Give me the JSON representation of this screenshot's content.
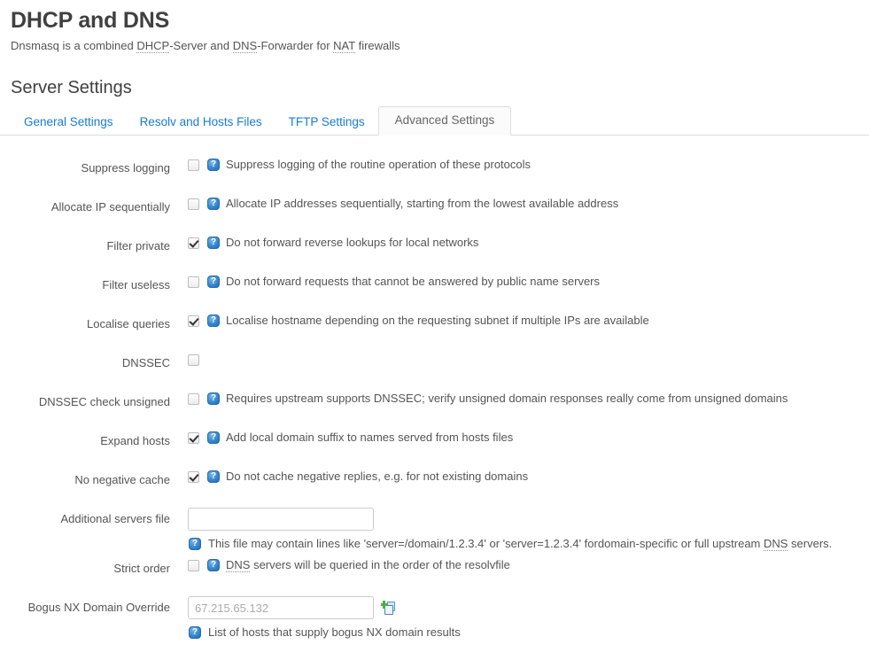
{
  "header": {
    "title": "DHCP and DNS",
    "subtitle_parts": [
      {
        "t": "Dnsmasq is a combined ",
        "abbr": false
      },
      {
        "t": "DHCP",
        "abbr": true
      },
      {
        "t": "-Server and ",
        "abbr": false
      },
      {
        "t": "DNS",
        "abbr": true
      },
      {
        "t": "-Forwarder for ",
        "abbr": false
      },
      {
        "t": "NAT",
        "abbr": true
      },
      {
        "t": " firewalls",
        "abbr": false
      }
    ],
    "subtitle_plain": "Dnsmasq is a combined DHCP-Server and DNS-Forwarder for NAT firewalls",
    "section_title": "Server Settings"
  },
  "tabs": [
    {
      "label": "General Settings",
      "active": false
    },
    {
      "label": "Resolv and Hosts Files",
      "active": false
    },
    {
      "label": "TFTP Settings",
      "active": false
    },
    {
      "label": "Advanced Settings",
      "active": true
    }
  ],
  "form": {
    "rows": [
      {
        "id": "suppress-logging",
        "label": "Suppress logging",
        "type": "checkbox",
        "checked": false,
        "help": "Suppress logging of the routine operation of these protocols"
      },
      {
        "id": "allocate-ip-sequentially",
        "label": "Allocate IP sequentially",
        "type": "checkbox",
        "checked": false,
        "help": "Allocate IP addresses sequentially, starting from the lowest available address"
      },
      {
        "id": "filter-private",
        "label": "Filter private",
        "type": "checkbox",
        "checked": true,
        "help": "Do not forward reverse lookups for local networks"
      },
      {
        "id": "filter-useless",
        "label": "Filter useless",
        "type": "checkbox",
        "checked": false,
        "help": "Do not forward requests that cannot be answered by public name servers"
      },
      {
        "id": "localise-queries",
        "label": "Localise queries",
        "type": "checkbox",
        "checked": true,
        "help": "Localise hostname depending on the requesting subnet if multiple IPs are available"
      },
      {
        "id": "dnssec",
        "label": "DNSSEC",
        "type": "checkbox",
        "checked": false,
        "help": ""
      },
      {
        "id": "dnssec-check-unsigned",
        "label": "DNSSEC check unsigned",
        "type": "checkbox",
        "checked": false,
        "help": "Requires upstream supports DNSSEC; verify unsigned domain responses really come from unsigned domains"
      },
      {
        "id": "expand-hosts",
        "label": "Expand hosts",
        "type": "checkbox",
        "checked": true,
        "help": "Add local domain suffix to names served from hosts files"
      },
      {
        "id": "no-negative-cache",
        "label": "No negative cache",
        "type": "checkbox",
        "checked": true,
        "help": "Do not cache negative replies, e.g. for not existing domains"
      }
    ],
    "additional_servers_file": {
      "label": "Additional servers file",
      "value": "",
      "placeholder": "",
      "help_pre": "This file may contain lines like 'server=/domain/1.2.3.4' or 'server=1.2.3.4' fordomain-specific or full upstream ",
      "help_abbr": "DNS",
      "help_post": " servers."
    },
    "strict_order": {
      "label": "Strict order",
      "checked": false,
      "help_abbr": "DNS",
      "help_post": " servers will be queried in the order of the resolvfile"
    },
    "bogus_nx": {
      "label": "Bogus NX Domain Override",
      "value": "",
      "placeholder": "67.215.65.132",
      "add_icon": "add-item-icon",
      "help": "List of hosts that supply bogus NX domain results"
    }
  },
  "colors": {
    "link": "#1a7bd4",
    "text": "#555555",
    "heading": "#404040",
    "border": "#dddddd",
    "help_icon": "#3c8fd4",
    "plus": "#4caf3f"
  }
}
